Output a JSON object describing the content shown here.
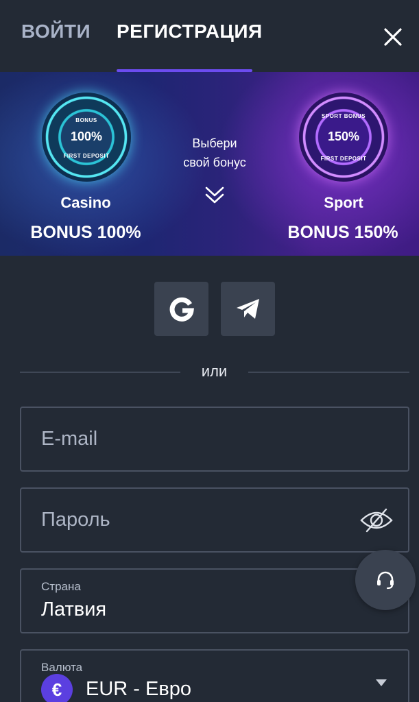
{
  "header": {
    "login_tab": "ВОЙТИ",
    "register_tab": "РЕГИСТРАЦИЯ",
    "active_tab": "register",
    "accent_color": "#6c4cf0",
    "close_icon": "close-icon"
  },
  "banner": {
    "casino": {
      "badge_top": "BONUS",
      "badge_value": "100%",
      "badge_bottom": "FIRST DEPOSIT",
      "name": "Casino",
      "bonus": "BONUS 100%"
    },
    "center_text_line1": "Выбери",
    "center_text_line2": "свой бонус",
    "sport": {
      "badge_top": "SPORT BONUS",
      "badge_value": "150%",
      "badge_bottom": "FIRST DEPOSIT",
      "name": "Sport",
      "bonus": "BONUS 150%"
    }
  },
  "social": {
    "google_icon": "google-icon",
    "telegram_icon": "telegram-icon"
  },
  "divider_text": "или",
  "form": {
    "email_placeholder": "E-mail",
    "password_placeholder": "Пароль",
    "country_label": "Страна",
    "country_value": "Латвия",
    "currency_label": "Валюта",
    "currency_symbol": "€",
    "currency_value": "EUR - Евро"
  },
  "support_icon": "headset-icon"
}
